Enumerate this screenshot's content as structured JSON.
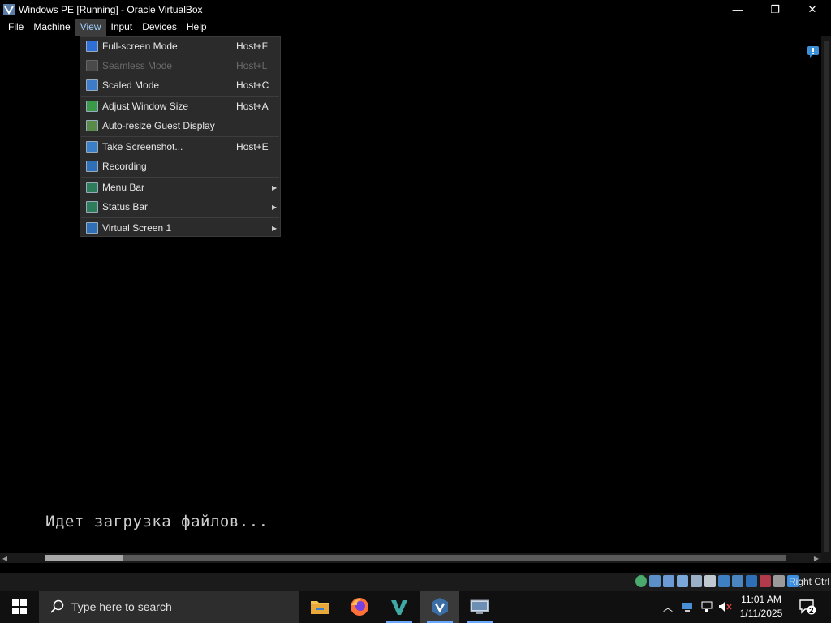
{
  "window": {
    "title": "Windows PE [Running] - Oracle VirtualBox",
    "minimize_glyph": "—",
    "maximize_glyph": "❐",
    "close_glyph": "✕"
  },
  "menubar": {
    "items": [
      "File",
      "Machine",
      "View",
      "Input",
      "Devices",
      "Help"
    ],
    "active": "View"
  },
  "view_menu": {
    "items": [
      {
        "label": "Full-screen Mode",
        "shortcut": "Host+F",
        "enabled": true,
        "submenu": false,
        "icon": "fullscreen-icon"
      },
      {
        "label": "Seamless Mode",
        "shortcut": "Host+L",
        "enabled": false,
        "submenu": false,
        "icon": "seamless-icon"
      },
      {
        "label": "Scaled Mode",
        "shortcut": "Host+C",
        "enabled": true,
        "submenu": false,
        "icon": "scaled-icon"
      },
      {
        "label": "Adjust Window Size",
        "shortcut": "Host+A",
        "enabled": true,
        "submenu": false,
        "icon": "adjust-window-icon"
      },
      {
        "label": "Auto-resize Guest Display",
        "shortcut": "",
        "enabled": true,
        "submenu": false,
        "icon": "auto-resize-icon"
      },
      {
        "label": "Take Screenshot...",
        "shortcut": "Host+E",
        "enabled": true,
        "submenu": false,
        "icon": "screenshot-icon"
      },
      {
        "label": "Recording",
        "shortcut": "",
        "enabled": true,
        "submenu": false,
        "icon": "recording-icon"
      },
      {
        "label": "Menu Bar",
        "shortcut": "",
        "enabled": true,
        "submenu": true,
        "icon": "menu-bar-icon"
      },
      {
        "label": "Status Bar",
        "shortcut": "",
        "enabled": true,
        "submenu": true,
        "icon": "status-bar-icon"
      },
      {
        "label": "Virtual Screen 1",
        "shortcut": "",
        "enabled": true,
        "submenu": true,
        "icon": "virtual-screen-icon"
      }
    ]
  },
  "guest": {
    "console_text": "Идет загрузка файлов..."
  },
  "statusbar": {
    "host_key": "Right Ctrl"
  },
  "taskbar": {
    "search_placeholder": "Type here to search",
    "apps": [
      "file-explorer-icon",
      "firefox-icon",
      "visual-studio-icon",
      "virtualbox-icon",
      "vm-window-icon"
    ],
    "clock_time": "11:01 AM",
    "clock_date": "1/11/2025",
    "notification_count": "2"
  },
  "colors": {
    "accent": "#6aa9ff",
    "menu_bg": "#2b2b2b",
    "active_menu_text": "#9fd0ff"
  }
}
